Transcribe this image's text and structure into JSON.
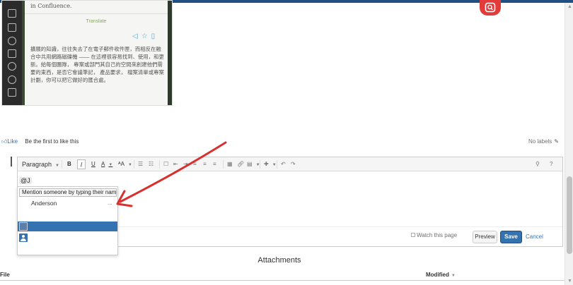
{
  "embed": {
    "top_text": "in Confluence.",
    "translate": "Translate",
    "chinese_text": "擴展的知識，往往失去了在電子郵件收件匣，而相反在融合中共用網路磁碟機 —— 在這裡很容易找到、使用，和更新。給每個團隊， 專案或部門其自己的空間來創建他們需要的東西，是否它會議筆記， 產品要求， 檔案清單或專案計劃，你可以把它做好的匯合處。"
  },
  "like": {
    "label": "Like",
    "first": "Be the first to like this"
  },
  "labels": {
    "text": "No labels"
  },
  "toolbar": {
    "paragraph": "Paragraph",
    "bold": "B",
    "italic": "I",
    "underline": "U",
    "text_color": "A",
    "text_size": "ᴬA",
    "search": "🔍",
    "help": "?"
  },
  "editor": {
    "mention_token": "@J"
  },
  "mention": {
    "hint": "Mention someone by typing their name...",
    "result": "Anderson",
    "dots": "..."
  },
  "bottombar": {
    "watch": "Watch this page",
    "preview": "Preview",
    "save": "Save",
    "cancel": "Cancel"
  },
  "attachments": {
    "title": "Attachments",
    "col_file": "File",
    "col_modified": "Modified"
  },
  "colors": {
    "primary": "#3572b0",
    "topbar": "#205081",
    "arrow": "#d8302e",
    "logo": "#e33a3a"
  }
}
